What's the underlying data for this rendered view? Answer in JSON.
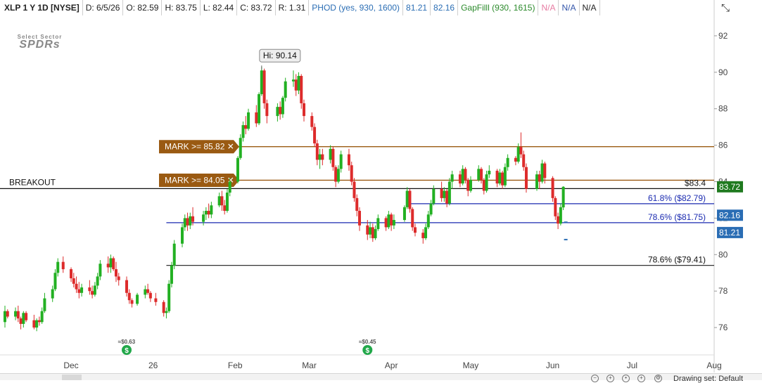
{
  "infobar": {
    "symbol": "XLP 1 Y 1D [NYSE]",
    "date": "D: 6/5/26",
    "open": "O: 82.59",
    "high": "H: 83.75",
    "low": "L: 82.44",
    "close": "C: 83.72",
    "range": "R: 1.31",
    "phod": "PHOD (yes, 930, 1600)",
    "phod_v1": "81.21",
    "phod_v2": "82.16",
    "gapfill": "GapFilll (930, 1615)",
    "na1": "N/A",
    "na2": "N/A",
    "na3": "N/A"
  },
  "logo": {
    "line1": "Select Sector",
    "line2": "SPDRs"
  },
  "colors": {
    "up": "#22b022",
    "down": "#dd2b2b",
    "mark": "#9a5a12",
    "fib": "#1a2ab0",
    "breakout": "#111111",
    "last_price_bg": "#1f7a1f",
    "phod_bg": "#2a6db4"
  },
  "chart_data": {
    "type": "candlestick",
    "y_range": [
      74.5,
      93
    ],
    "y_ticks": [
      "76",
      "78",
      "80",
      "82",
      "84",
      "86",
      "88",
      "90",
      "92"
    ],
    "x_tick_labels": [
      "Dec",
      "26",
      "Feb",
      "Mar",
      "Apr",
      "May",
      "Jun",
      "Jul",
      "Aug"
    ],
    "x_tick_dates": [
      "2025-12-01",
      "2026-01-01",
      "2026-02-01",
      "2026-03-01",
      "2026-04-01",
      "2026-05-01",
      "2026-06-01",
      "2026-07-01",
      "2026-08-01"
    ],
    "x_range_dates": [
      "2025-11-06",
      "2026-08-01"
    ],
    "candles": [
      [
        "2025-11-06",
        76.3,
        77.2,
        76.0,
        76.9
      ],
      [
        "2025-11-07",
        76.9,
        77.0,
        76.5,
        76.6
      ],
      [
        "2025-11-10",
        76.6,
        77.1,
        76.4,
        76.9
      ],
      [
        "2025-11-11",
        76.9,
        77.2,
        76.3,
        76.5
      ],
      [
        "2025-11-12",
        76.5,
        76.6,
        75.9,
        76.2
      ],
      [
        "2025-11-13",
        76.2,
        76.9,
        76.0,
        76.8
      ],
      [
        "2025-11-14",
        76.8,
        76.9,
        76.3,
        76.4
      ],
      [
        "2025-11-17",
        76.4,
        76.7,
        75.9,
        76.0
      ],
      [
        "2025-11-18",
        76.0,
        76.5,
        75.8,
        76.4
      ],
      [
        "2025-11-19",
        76.4,
        76.6,
        76.1,
        76.3
      ],
      [
        "2025-11-20",
        76.3,
        77.1,
        76.2,
        76.9
      ],
      [
        "2025-11-21",
        76.9,
        77.9,
        76.8,
        77.6
      ],
      [
        "2025-11-24",
        77.6,
        78.3,
        77.4,
        78.1
      ],
      [
        "2025-11-25",
        78.1,
        79.2,
        78.0,
        79.0
      ],
      [
        "2025-11-26",
        79.0,
        79.8,
        78.8,
        79.6
      ],
      [
        "2025-11-28",
        79.6,
        79.9,
        79.0,
        79.2
      ],
      [
        "2025-12-01",
        79.2,
        79.3,
        78.5,
        78.7
      ],
      [
        "2025-12-02",
        78.7,
        79.0,
        78.2,
        78.4
      ],
      [
        "2025-12-03",
        78.4,
        78.8,
        77.9,
        78.1
      ],
      [
        "2025-12-04",
        78.1,
        78.5,
        77.6,
        77.9
      ],
      [
        "2025-12-05",
        77.9,
        78.4,
        77.7,
        78.2
      ],
      [
        "2025-12-08",
        78.2,
        78.6,
        77.8,
        78.0
      ],
      [
        "2025-12-09",
        78.0,
        78.3,
        77.6,
        77.8
      ],
      [
        "2025-12-10",
        77.8,
        78.5,
        77.7,
        78.3
      ],
      [
        "2025-12-11",
        78.3,
        79.0,
        78.1,
        78.8
      ],
      [
        "2025-12-12",
        78.8,
        79.7,
        78.6,
        79.5
      ],
      [
        "2025-12-15",
        79.5,
        79.9,
        79.0,
        79.3
      ],
      [
        "2025-12-16",
        79.3,
        80.0,
        79.0,
        79.8
      ],
      [
        "2025-12-17",
        79.8,
        79.9,
        79.1,
        79.2
      ],
      [
        "2025-12-18",
        79.2,
        79.6,
        78.5,
        78.8
      ],
      [
        "2025-12-19",
        78.8,
        79.0,
        78.3,
        78.6
      ],
      [
        "2025-12-22",
        78.6,
        78.8,
        77.7,
        77.9
      ],
      [
        "2025-12-23",
        77.9,
        78.1,
        77.3,
        77.5
      ],
      [
        "2025-12-24",
        77.5,
        77.6,
        77.1,
        77.3
      ],
      [
        "2025-12-26",
        77.3,
        77.9,
        77.2,
        77.8
      ],
      [
        "2025-12-29",
        77.8,
        78.3,
        77.6,
        78.1
      ],
      [
        "2025-12-30",
        78.1,
        78.4,
        77.8,
        77.9
      ],
      [
        "2025-12-31",
        77.9,
        78.0,
        77.4,
        77.6
      ],
      [
        "2026-01-02",
        77.6,
        77.9,
        77.2,
        77.4
      ],
      [
        "2026-01-05",
        77.4,
        77.5,
        76.6,
        76.8
      ],
      [
        "2026-01-06",
        76.8,
        77.1,
        76.5,
        76.9
      ],
      [
        "2026-01-07",
        76.9,
        78.6,
        76.8,
        78.4
      ],
      [
        "2026-01-08",
        78.4,
        79.6,
        78.2,
        79.4
      ],
      [
        "2026-01-09",
        79.4,
        80.8,
        79.2,
        80.6
      ],
      [
        "2026-01-12",
        80.6,
        81.7,
        80.4,
        81.5
      ],
      [
        "2026-01-13",
        81.5,
        82.2,
        81.3,
        82.0
      ],
      [
        "2026-01-14",
        82.0,
        82.3,
        81.3,
        81.6
      ],
      [
        "2026-01-15",
        81.6,
        82.3,
        81.4,
        82.1
      ],
      [
        "2026-01-16",
        82.1,
        82.6,
        81.6,
        81.8
      ],
      [
        "2026-01-20",
        81.8,
        82.4,
        81.6,
        82.2
      ],
      [
        "2026-01-21",
        82.2,
        82.6,
        81.9,
        82.4
      ],
      [
        "2026-01-22",
        82.4,
        82.8,
        82.0,
        82.2
      ],
      [
        "2026-01-23",
        82.2,
        82.9,
        82.0,
        82.7
      ],
      [
        "2026-01-26",
        82.7,
        83.4,
        82.6,
        83.2
      ],
      [
        "2026-01-27",
        83.2,
        83.5,
        82.4,
        82.7
      ],
      [
        "2026-01-28",
        82.7,
        83.0,
        82.2,
        82.4
      ],
      [
        "2026-01-29",
        82.4,
        83.6,
        82.3,
        83.4
      ],
      [
        "2026-01-30",
        83.4,
        84.2,
        83.2,
        84.0
      ],
      [
        "2026-02-02",
        84.0,
        85.4,
        83.9,
        85.3
      ],
      [
        "2026-02-03",
        85.3,
        86.6,
        85.2,
        86.4
      ],
      [
        "2026-02-04",
        86.4,
        87.3,
        86.2,
        87.1
      ],
      [
        "2026-02-05",
        87.1,
        87.6,
        86.6,
        86.9
      ],
      [
        "2026-02-06",
        86.9,
        88.0,
        86.8,
        87.8
      ],
      [
        "2026-02-09",
        87.8,
        88.2,
        87.0,
        87.2
      ],
      [
        "2026-02-10",
        87.2,
        88.9,
        87.1,
        88.8
      ],
      [
        "2026-02-11",
        88.8,
        90.3,
        88.7,
        90.1
      ],
      [
        "2026-02-12",
        90.1,
        90.2,
        88.0,
        88.3
      ],
      [
        "2026-02-13",
        88.3,
        88.5,
        87.2,
        87.6
      ],
      [
        "2026-02-17",
        87.6,
        88.3,
        87.3,
        88.1
      ],
      [
        "2026-02-18",
        88.1,
        88.4,
        87.4,
        87.7
      ],
      [
        "2026-02-19",
        87.7,
        88.7,
        87.5,
        88.6
      ],
      [
        "2026-02-20",
        88.6,
        89.7,
        88.4,
        89.5
      ],
      [
        "2026-02-23",
        89.5,
        90.1,
        89.2,
        89.6
      ],
      [
        "2026-02-24",
        89.6,
        89.9,
        88.7,
        89.0
      ],
      [
        "2026-02-25",
        89.0,
        90.0,
        88.8,
        89.8
      ],
      [
        "2026-02-26",
        89.8,
        89.9,
        88.0,
        88.3
      ],
      [
        "2026-02-27",
        88.3,
        88.5,
        87.3,
        87.6
      ],
      [
        "2026-03-02",
        87.6,
        87.8,
        86.8,
        87.0
      ],
      [
        "2026-03-03",
        87.0,
        87.2,
        85.9,
        86.1
      ],
      [
        "2026-03-04",
        86.1,
        86.3,
        84.9,
        85.2
      ],
      [
        "2026-03-05",
        85.2,
        85.8,
        84.7,
        85.5
      ],
      [
        "2026-03-06",
        85.5,
        85.8,
        84.9,
        85.2
      ],
      [
        "2026-03-09",
        85.2,
        86.0,
        85.0,
        85.8
      ],
      [
        "2026-03-10",
        85.8,
        85.9,
        84.6,
        84.8
      ],
      [
        "2026-03-11",
        84.8,
        84.9,
        83.7,
        84.0
      ],
      [
        "2026-03-12",
        84.0,
        84.9,
        83.9,
        84.7
      ],
      [
        "2026-03-13",
        84.7,
        85.7,
        84.5,
        85.5
      ],
      [
        "2026-03-16",
        85.5,
        85.8,
        84.6,
        84.9
      ],
      [
        "2026-03-17",
        84.9,
        85.1,
        83.8,
        84.0
      ],
      [
        "2026-03-18",
        84.0,
        84.2,
        82.9,
        83.1
      ],
      [
        "2026-03-19",
        83.1,
        83.3,
        82.1,
        82.4
      ],
      [
        "2026-03-20",
        82.4,
        82.6,
        81.3,
        81.6
      ],
      [
        "2026-03-23",
        81.6,
        81.9,
        80.8,
        81.1
      ],
      [
        "2026-03-24",
        81.1,
        81.8,
        80.9,
        81.5
      ],
      [
        "2026-03-25",
        81.5,
        81.7,
        80.7,
        80.9
      ],
      [
        "2026-03-26",
        80.9,
        81.6,
        80.8,
        81.4
      ],
      [
        "2026-03-27",
        81.4,
        82.2,
        81.3,
        82.0
      ],
      [
        "2026-03-30",
        82.0,
        82.1,
        81.3,
        81.5
      ],
      [
        "2026-03-31",
        81.5,
        82.4,
        81.4,
        82.2
      ],
      [
        "2026-04-01",
        82.2,
        82.3,
        81.3,
        81.6
      ],
      [
        "2026-04-02",
        81.6,
        82.2,
        81.4,
        81.9
      ],
      [
        "2026-04-06",
        81.9,
        82.7,
        81.8,
        82.6
      ],
      [
        "2026-04-07",
        82.6,
        83.7,
        82.5,
        83.5
      ],
      [
        "2026-04-08",
        83.5,
        83.6,
        82.3,
        82.5
      ],
      [
        "2026-04-09",
        82.5,
        82.6,
        81.3,
        81.5
      ],
      [
        "2026-04-10",
        81.5,
        81.7,
        81.0,
        81.2
      ],
      [
        "2026-04-13",
        81.2,
        81.4,
        80.6,
        80.9
      ],
      [
        "2026-04-14",
        80.9,
        81.7,
        80.8,
        81.5
      ],
      [
        "2026-04-15",
        81.5,
        82.4,
        81.4,
        82.2
      ],
      [
        "2026-04-16",
        82.2,
        83.0,
        82.1,
        82.8
      ],
      [
        "2026-04-17",
        82.8,
        83.8,
        82.7,
        83.6
      ],
      [
        "2026-04-20",
        83.6,
        84.0,
        82.9,
        83.1
      ],
      [
        "2026-04-21",
        83.1,
        83.7,
        82.9,
        83.5
      ],
      [
        "2026-04-22",
        83.5,
        83.6,
        82.6,
        82.8
      ],
      [
        "2026-04-23",
        82.8,
        84.2,
        82.7,
        84.0
      ],
      [
        "2026-04-24",
        84.0,
        84.6,
        83.6,
        84.4
      ],
      [
        "2026-04-27",
        84.4,
        84.6,
        83.7,
        83.9
      ],
      [
        "2026-04-28",
        83.9,
        84.9,
        83.8,
        84.7
      ],
      [
        "2026-04-29",
        84.7,
        84.8,
        83.9,
        84.1
      ],
      [
        "2026-04-30",
        84.1,
        84.2,
        83.2,
        83.5
      ],
      [
        "2026-05-01",
        83.5,
        84.3,
        83.4,
        84.1
      ],
      [
        "2026-05-04",
        84.1,
        84.9,
        84.0,
        84.7
      ],
      [
        "2026-05-05",
        84.7,
        84.8,
        83.9,
        84.1
      ],
      [
        "2026-05-06",
        84.1,
        84.2,
        83.3,
        83.5
      ],
      [
        "2026-05-07",
        83.5,
        84.6,
        83.4,
        84.4
      ],
      [
        "2026-05-08",
        84.4,
        84.9,
        84.2,
        84.6
      ],
      [
        "2026-05-11",
        84.6,
        84.7,
        83.7,
        83.9
      ],
      [
        "2026-05-12",
        83.9,
        84.7,
        83.8,
        84.5
      ],
      [
        "2026-05-13",
        84.5,
        84.6,
        83.6,
        83.8
      ],
      [
        "2026-05-14",
        83.8,
        85.0,
        83.7,
        84.8
      ],
      [
        "2026-05-15",
        84.8,
        85.5,
        84.6,
        85.3
      ],
      [
        "2026-05-18",
        85.3,
        85.4,
        84.9,
        85.1
      ],
      [
        "2026-05-19",
        85.1,
        86.1,
        85.0,
        85.9
      ],
      [
        "2026-05-20",
        85.9,
        86.7,
        85.3,
        85.5
      ],
      [
        "2026-05-21",
        85.5,
        85.7,
        84.6,
        84.8
      ],
      [
        "2026-05-22",
        84.8,
        85.0,
        83.4,
        83.6
      ],
      [
        "2026-05-26",
        83.6,
        84.6,
        83.5,
        84.4
      ],
      [
        "2026-05-27",
        84.4,
        84.6,
        83.6,
        84.0
      ],
      [
        "2026-05-28",
        84.0,
        85.2,
        83.9,
        85.0
      ],
      [
        "2026-05-29",
        85.0,
        85.1,
        83.9,
        84.2
      ],
      [
        "2026-06-01",
        84.2,
        84.3,
        82.9,
        83.1
      ],
      [
        "2026-06-02",
        83.1,
        83.2,
        81.9,
        82.1
      ],
      [
        "2026-06-03",
        82.1,
        82.3,
        81.4,
        81.7
      ],
      [
        "2026-06-04",
        81.7,
        82.8,
        81.6,
        82.6
      ],
      [
        "2026-06-05",
        82.59,
        83.75,
        82.44,
        83.72
      ]
    ],
    "hi_label": "Hi: 90.14",
    "hi_date": "2026-02-11",
    "hi_value": 90.14,
    "horizontal_lines": [
      {
        "name": "mark-85",
        "value": 85.92,
        "color": "#9a5a12",
        "start_date": "2026-01-21",
        "end_date": "2026-08-01",
        "label": "MARK >= 85.82 ✕"
      },
      {
        "name": "mark-84",
        "value": 84.08,
        "color": "#9a5a12",
        "start_date": "2026-01-21",
        "end_date": "2026-08-01",
        "label": "MARK >= 84.05 ✕"
      },
      {
        "name": "breakout",
        "value": 83.62,
        "color": "#111111",
        "start_date": "2025-11-06",
        "end_date": "2026-08-01",
        "label": "BREAKOUT",
        "right_label": "$83.4"
      },
      {
        "name": "fib-61",
        "value": 82.79,
        "color": "#1a2ab0",
        "start_date": "2026-04-08",
        "end_date": "2026-08-01",
        "right_label": "61.8%  ($82.79)"
      },
      {
        "name": "fib-786-upper",
        "value": 81.75,
        "color": "#1a2ab0",
        "start_date": "2026-01-06",
        "end_date": "2026-08-01",
        "right_label": "78.6%  ($81.75)"
      },
      {
        "name": "fib-786-lower",
        "value": 79.41,
        "color": "#333333",
        "start_date": "2026-01-06",
        "end_date": "2026-08-01",
        "right_label": "78.6%  ($79.41)"
      }
    ],
    "price_badges": [
      {
        "name": "last-price",
        "value": 83.72,
        "text": "83.72",
        "color": "#1f7a1f"
      },
      {
        "name": "phod-high",
        "value": 82.16,
        "text": "82.16",
        "color": "#2a6db4"
      },
      {
        "name": "phod-low",
        "value": 81.21,
        "text": "81.21",
        "color": "#2a6db4"
      }
    ],
    "dividends": [
      {
        "date": "2025-12-22",
        "text": "≈$0.63"
      },
      {
        "date": "2026-03-23",
        "text": "≈$0.45"
      }
    ],
    "dividend_icon_glyph": "$",
    "current_marks": [
      {
        "value": 82.16,
        "date": "2026-06-05"
      },
      {
        "value": 81.21,
        "date": "2026-06-05"
      }
    ]
  },
  "bottombar": {
    "drawing_set": "Drawing set: Default"
  }
}
